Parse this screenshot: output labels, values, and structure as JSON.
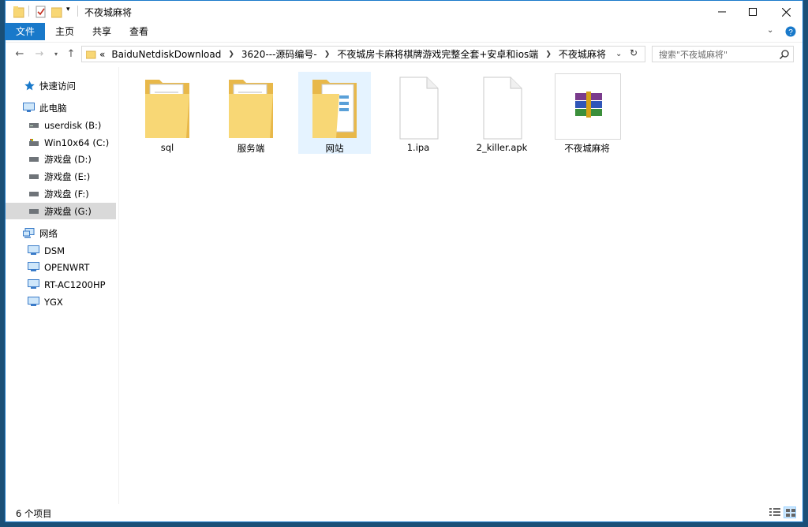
{
  "window": {
    "title": "不夜城麻将"
  },
  "ribbon": {
    "tabs": [
      "文件",
      "主页",
      "共享",
      "查看"
    ]
  },
  "address": {
    "breadcrumb": [
      "BaiduNetdiskDownload",
      "3620---源码编号-",
      "不夜城房卡麻将棋牌游戏完整全套+安卓和ios端",
      "不夜城麻将"
    ],
    "overflow": "«"
  },
  "search": {
    "placeholder": "搜索\"不夜城麻将\""
  },
  "sidebar": {
    "quick_access": "快速访问",
    "this_pc": "此电脑",
    "drives": [
      "userdisk (B:)",
      "Win10x64 (C:)",
      "游戏盘 (D:)",
      "游戏盘 (E:)",
      "游戏盘 (F:)",
      "游戏盘 (G:)"
    ],
    "network": "网络",
    "network_items": [
      "DSM",
      "OPENWRT",
      "RT-AC1200HP",
      "YGX"
    ]
  },
  "files": [
    {
      "name": "sql",
      "type": "folder"
    },
    {
      "name": "服务端",
      "type": "folder"
    },
    {
      "name": "网站",
      "type": "folder"
    },
    {
      "name": "1.ipa",
      "type": "file"
    },
    {
      "name": "2_killer.apk",
      "type": "file"
    },
    {
      "name": "不夜城麻将",
      "type": "archive"
    }
  ],
  "status": {
    "count": "6 个项目"
  },
  "colors": {
    "accent": "#1979ca",
    "selected": "#e5f3ff",
    "folder": "#f8d775"
  }
}
